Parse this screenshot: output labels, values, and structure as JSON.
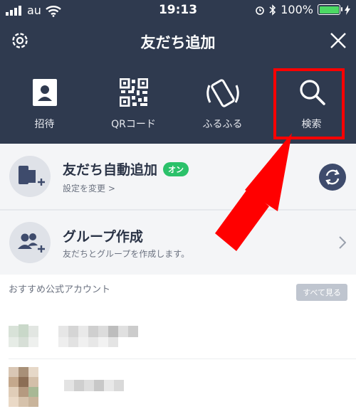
{
  "status": {
    "carrier": "au",
    "time": "19:13",
    "battery": "100%",
    "battery_level": 1.0,
    "icons": [
      "signal-bars-icon",
      "wifi-icon",
      "alarm-icon",
      "bluetooth-icon",
      "battery-icon",
      "charging-icon"
    ]
  },
  "header": {
    "title": "友だち追加",
    "left_icon": "gear-icon",
    "right_icon": "close-icon"
  },
  "actions": [
    {
      "label": "招待",
      "icon": "contact-card-icon"
    },
    {
      "label": "QRコード",
      "icon": "qr-code-icon"
    },
    {
      "label": "ふるふる",
      "icon": "shake-phone-icon"
    },
    {
      "label": "検索",
      "icon": "search-icon"
    }
  ],
  "auto_add": {
    "title": "友だち自動追加",
    "badge": "オン",
    "subtitle": "設定を変更 >"
  },
  "group": {
    "title": "グループ作成",
    "subtitle": "友だちとグループを作成します。"
  },
  "recommended": {
    "header": "おすすめ公式アカウント",
    "see_all": "すべて見る"
  },
  "colors": {
    "header_bg": "#2f3a4f",
    "accent_green": "#2bc16a",
    "highlight_red": "#ff0000",
    "row_bg": "#f4f5f7"
  }
}
